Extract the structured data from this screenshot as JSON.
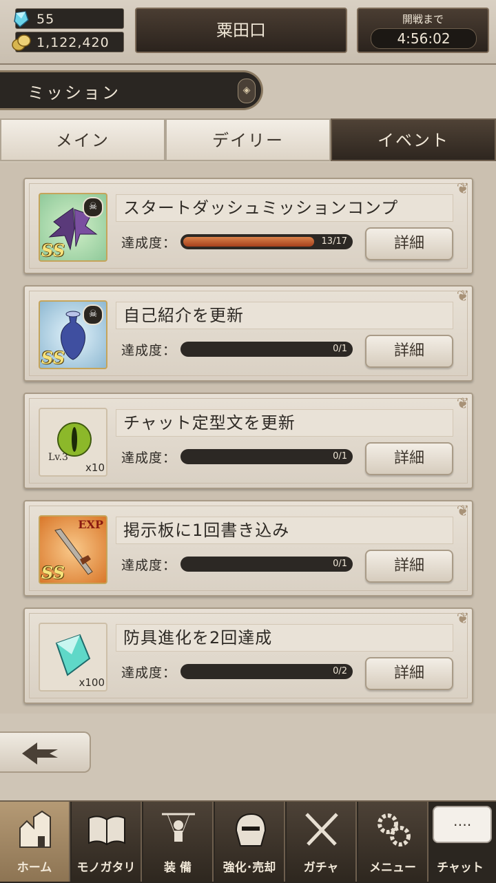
{
  "header": {
    "gems": "55",
    "coins": "1,122,420",
    "player_name": "粟田口",
    "battle_label": "開戦まで",
    "battle_time": "4:56:02"
  },
  "screen_title": "ミッション",
  "tabs": [
    {
      "label": "メイン",
      "active": false
    },
    {
      "label": "デイリー",
      "active": false
    },
    {
      "label": "イベント",
      "active": true
    }
  ],
  "progress_label": "達成度：",
  "detail_label": "詳細",
  "missions": [
    {
      "title": "スタートダッシュミッションコンプ",
      "progress": "13/17",
      "fraction": 0.765,
      "reward": "ss-wing",
      "rank": "SS",
      "qty": ""
    },
    {
      "title": "自己紹介を更新",
      "progress": "0/1",
      "fraction": 0,
      "reward": "ss-vase",
      "rank": "SS",
      "qty": ""
    },
    {
      "title": "チャット定型文を更新",
      "progress": "0/1",
      "fraction": 0,
      "reward": "eye-orb",
      "rank": "",
      "lv": "Lv.3",
      "qty": "x10"
    },
    {
      "title": "掲示板に1回書き込み",
      "progress": "0/1",
      "fraction": 0,
      "reward": "exp-sword",
      "rank": "SS",
      "badge": "EXP",
      "qty": ""
    },
    {
      "title": "防具進化を2回達成",
      "progress": "0/2",
      "fraction": 0,
      "reward": "crystal",
      "rank": "",
      "qty": "x100"
    }
  ],
  "nav": [
    {
      "label": "ホーム",
      "icon": "castle-icon",
      "active": true
    },
    {
      "label": "モノガタリ",
      "icon": "book-icon",
      "active": false
    },
    {
      "label": "装 備",
      "icon": "puppet-icon",
      "active": false
    },
    {
      "label": "強化･売却",
      "icon": "helmet-icon",
      "active": false
    },
    {
      "label": "ガチャ",
      "icon": "swords-icon",
      "active": false
    },
    {
      "label": "メニュー",
      "icon": "gears-icon",
      "active": false
    }
  ],
  "chat": {
    "label": "チャット",
    "bubble": "…."
  },
  "colors": {
    "accent_dark": "#2b2620",
    "progress_fill": "#c0582a",
    "gold": "#c5a45a"
  }
}
